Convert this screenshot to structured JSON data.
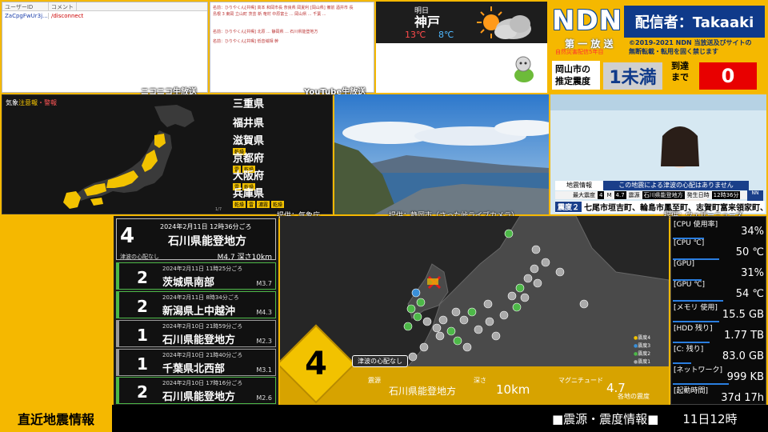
{
  "comments": {
    "header_user": "ユーザーID",
    "header_comment": "コメント",
    "rows": [
      {
        "user": "ZaCpgFwUr3j...",
        "comment": "/disconnect"
      }
    ]
  },
  "nico_label": "ニコニコ生放送",
  "youtube_label": "YouTube生放送",
  "ytchat": {
    "lines": [
      "名前：ひりやくん[共鳴] 高本 和岡市長 奈良県 岡夏利 [岡山県] 備前 酒井市 長",
      "島根 3 東岡 立山町 茨芸 新 奄村 中原富士 ... 岡山県 ... 千葉 ...",
      "名前：ひりやくん[共鳴] 北原 ... 静岡県 ... 石川県能登地方",
      "名前：ひりやくん[共鳴] 低音域相 幹"
    ]
  },
  "weather": {
    "day": "明日",
    "city": "神戸",
    "high": "13℃",
    "low": "8℃",
    "icon": "sun-cloud-icon"
  },
  "ndn": {
    "logo": "NDN",
    "broadcaster": "配信者：Takaaki",
    "first_broadcast": "第 一 放 送",
    "sub_tag": "自然災害配信5年目",
    "copyright_1": "©2019-2021 NDN 当放送及びサイトの",
    "copyright_2": "無断転載・転用を固く禁じます",
    "pred_label_1": "岡山市の",
    "pred_label_2": "推定震度",
    "pred_value": "1未満",
    "arrive_label_1": "到達",
    "arrive_label_2": "まで",
    "arrive_value": "0"
  },
  "alertmap": {
    "title_a": "気象",
    "title_b": "注意報",
    "title_c": "・警報",
    "page": "1/7",
    "source": "提供：気象庁",
    "prefs": [
      {
        "name": "三重県",
        "tags": []
      },
      {
        "name": "福井県",
        "tags": []
      },
      {
        "name": "滋賀県",
        "tags": [
          "乾燥"
        ]
      },
      {
        "name": "京都府",
        "tags": [
          "雷",
          "乾燥"
        ]
      },
      {
        "name": "大阪府",
        "tags": [
          "雷",
          "乾燥"
        ]
      },
      {
        "name": "兵庫県",
        "tags": [
          "乾燥",
          "雷",
          "濃霧",
          "乾燥"
        ]
      }
    ]
  },
  "camera": {
    "source": "提供：静岡市（さった峠ライブカメラ）"
  },
  "news": {
    "label": "地震情報",
    "headline": "この地震による津波の心配はありません",
    "max_label": "最大震度",
    "max_value": "4",
    "mag_label": "M",
    "mag_value": "4.7",
    "epicenter_label": "震源",
    "epicenter": "石川県能登地方",
    "time_label": "発生日時",
    "time_value": "12時36分",
    "ticker_label": "震度２",
    "ticker_text": "七尾市垣吉町、輪島市鳳至町、志賀町富来領家町、",
    "source": "提供：ウェザーニューズ"
  },
  "quakes": [
    {
      "shindo": "4",
      "datetime": "2024年2月11日 12時36分ごろ",
      "location": "石川県能登地方",
      "tsunami": "津波の心配なし",
      "mag": "M4.7 深さ10km",
      "color": "#ffffff"
    },
    {
      "shindo": "2",
      "datetime": "2024年2月11日 11時25分ごろ",
      "location": "茨城県南部",
      "mag": "M3.7",
      "color": "#4db848"
    },
    {
      "shindo": "2",
      "datetime": "2024年2月11日 8時34分ごろ",
      "location": "新潟県上中越沖",
      "mag": "M4.3",
      "color": "#4db848"
    },
    {
      "shindo": "1",
      "datetime": "2024年2月10日 21時59分ごろ",
      "location": "石川県能登地方",
      "mag": "M2.3",
      "color": "#999999"
    },
    {
      "shindo": "1",
      "datetime": "2024年2月10日 21時40分ごろ",
      "location": "千葉県北西部",
      "mag": "M3.1",
      "color": "#999999"
    },
    {
      "shindo": "2",
      "datetime": "2024年2月10日 17時16分ごろ",
      "location": "石川県能登地方",
      "mag": "M2.6",
      "color": "#4db848"
    }
  ],
  "quakemap": {
    "shindo": "4",
    "tsunami": "津波の心配なし",
    "epicenter_label": "震源",
    "epicenter": "石川県能登地方",
    "depth_label": "深さ",
    "depth": "10km",
    "mag_label": "マグニチュード",
    "mag": "4.7",
    "max_note": "各地の震度",
    "legend": [
      {
        "label": "震度4",
        "color": "#f2c200"
      },
      {
        "label": "震度3",
        "color": "#3a8fd8"
      },
      {
        "label": "震度2",
        "color": "#4db848"
      },
      {
        "label": "震度1",
        "color": "#aaaaaa"
      }
    ]
  },
  "sysmon": [
    {
      "label": "[CPU 使用率]",
      "value": "34%",
      "level": 0.34
    },
    {
      "label": "[CPU ℃]",
      "value": "50 ℃",
      "level": 0.5
    },
    {
      "label": "[GPU]",
      "value": "31%",
      "level": 0.31
    },
    {
      "label": "[GPU ℃]",
      "value": "54 ℃",
      "level": 0.54
    },
    {
      "label": "[メモリ 使用]",
      "value": "15.5 GB",
      "level": 0.5
    },
    {
      "label": "[HDD 残り]",
      "value": "1.77 TB",
      "level": 0.4
    },
    {
      "label": "[C: 残り]",
      "value": "83.0 GB",
      "level": 0.2
    },
    {
      "label": "[ネットワーク]",
      "value": "999 KB",
      "level": 0.6
    },
    {
      "label": "[起動時間]",
      "value": "37d 17h",
      "level": 0
    }
  ],
  "bottom": {
    "title": "直近地震情報",
    "ticker": "■震源・震度情報■　　11日12時"
  }
}
